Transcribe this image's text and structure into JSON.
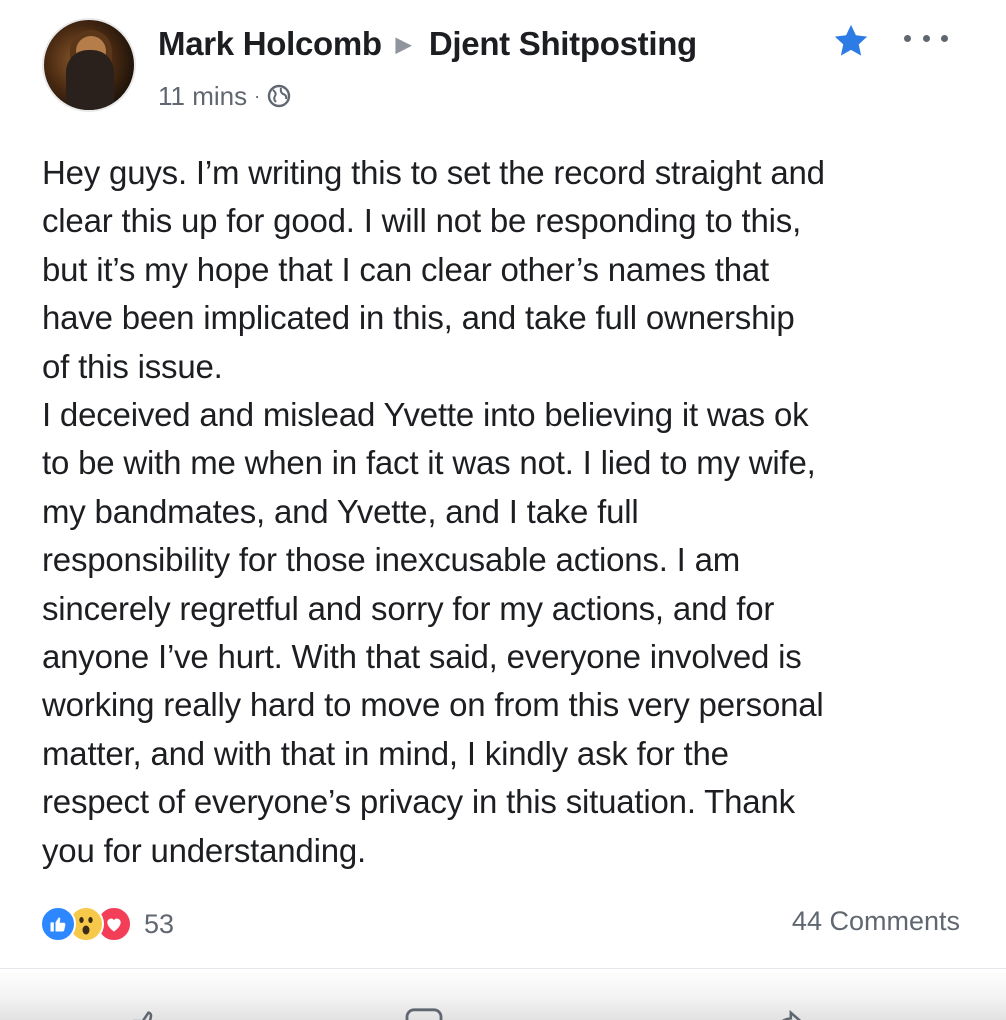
{
  "post": {
    "author": "Mark Holcomb",
    "group": "Djent Shitposting",
    "timestamp": "11 mins",
    "audience_icon": "globe-icon",
    "favorite_icon": "star-icon",
    "menu_icon": "more-options-icon",
    "body_lines": [
      "Hey guys. I’m writing this to set the record straight and",
      "clear this up for good. I will not be responding to this,",
      "but it’s my hope that I can clear other’s names that",
      "have been implicated in this, and take full ownership",
      "of this issue.",
      "I deceived and mislead Yvette into believing it was ok",
      "to be with me when in fact it was not. I lied to my wife,",
      "my bandmates, and Yvette, and I take full",
      "responsibility for those inexcusable actions. I am",
      "sincerely regretful and sorry for my actions, and for",
      "anyone I’ve hurt. With that said, everyone involved is",
      "working really hard to move on from this very personal",
      "matter, and with that in mind, I kindly ask for the",
      "respect of everyone’s privacy in this situation. Thank",
      "you for understanding."
    ]
  },
  "reactions": {
    "icons": [
      "like-reaction-icon",
      "wow-reaction-icon",
      "love-reaction-icon"
    ],
    "count": "53"
  },
  "comments_label": "44 Comments",
  "actions": {
    "like_label": "",
    "comment_label": "",
    "share_label": ""
  },
  "colors": {
    "like_blue": "#2d88ff",
    "love_red": "#f33e58",
    "wow_yellow": "#f7c94a",
    "meta_gray": "#606770",
    "text": "#1c1e21"
  }
}
